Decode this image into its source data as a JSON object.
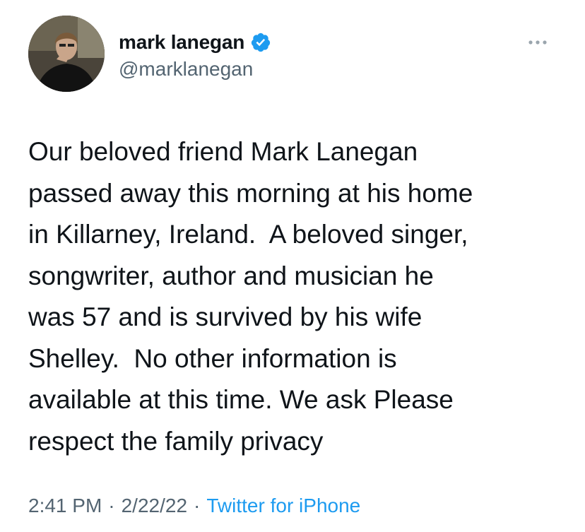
{
  "tweet": {
    "author": {
      "display_name": "mark lanegan",
      "handle": "@marklanegan",
      "verified": true,
      "verified_icon": "verified-badge-icon",
      "avatar_icon": "profile-photo"
    },
    "more_icon": "more-options-icon",
    "text": "Our beloved friend Mark Lanegan\npassed away this morning at his home\nin Killarney, Ireland.  A beloved singer,\nsongwriter, author and musician he\nwas 57 and is survived by his wife\nShelley.  No other information is\navailable at this time. We ask Please\nrespect the family privacy",
    "meta": {
      "time": "2:41 PM",
      "separator": "·",
      "date": "2/22/22",
      "source": "Twitter for iPhone"
    }
  },
  "colors": {
    "text_primary": "#0f1419",
    "text_secondary": "#536471",
    "accent": "#1d9bf0",
    "background": "#ffffff"
  }
}
